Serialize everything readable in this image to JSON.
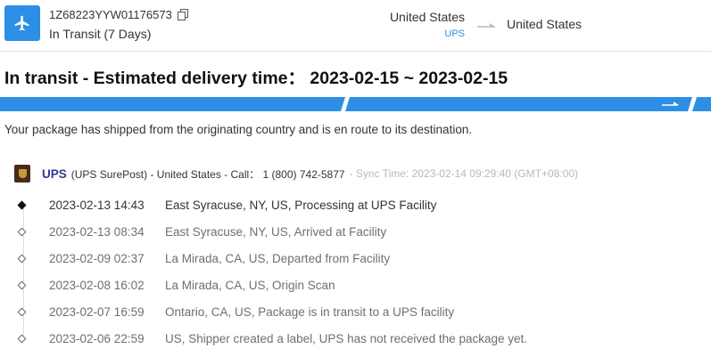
{
  "header": {
    "tracking_number": "1Z68223YYW01176573",
    "status": "In Transit (7 Days)",
    "origin": "United States",
    "carrier_short": "UPS",
    "destination": "United States"
  },
  "headline": "In transit - Estimated delivery time： 2023-02-15 ~ 2023-02-15",
  "progress": {
    "accent": "#2d8ee6",
    "stages_completed": 3,
    "stages_total": 3
  },
  "message": "Your package has shipped from the originating country and is en route to its destination.",
  "carrier": {
    "name": "UPS",
    "detail": "(UPS SurePost) - United States - Call： 1 (800) 742-5877",
    "sync_time": "- Sync Time: 2023-02-14 09:29:40 (GMT+08:00)",
    "logo_color": "#4a2a1a"
  },
  "events": [
    {
      "time": "2023-02-13 14:43",
      "desc": "East Syracuse, NY, US, Processing at UPS Facility"
    },
    {
      "time": "2023-02-13 08:34",
      "desc": "East Syracuse, NY, US, Arrived at Facility"
    },
    {
      "time": "2023-02-09 02:37",
      "desc": "La Mirada, CA, US, Departed from Facility"
    },
    {
      "time": "2023-02-08 16:02",
      "desc": "La Mirada, CA, US, Origin Scan"
    },
    {
      "time": "2023-02-07 16:59",
      "desc": "Ontario, CA, US, Package is in transit to a UPS facility"
    },
    {
      "time": "2023-02-06 22:59",
      "desc": "US, Shipper created a label, UPS has not received the package yet."
    }
  ]
}
